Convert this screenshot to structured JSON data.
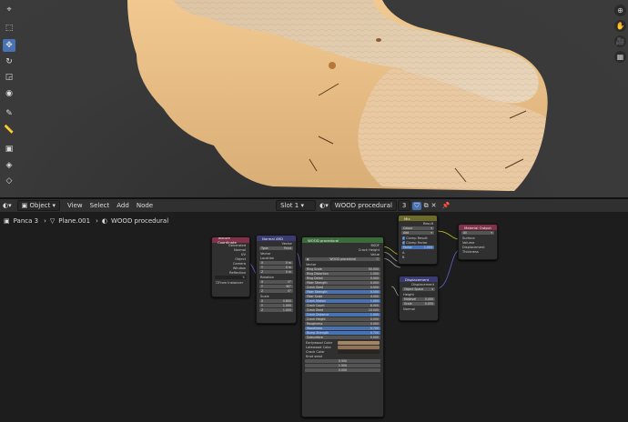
{
  "viewport": {
    "wood_color": "#e9c59b",
    "tools_left": [
      "cursor-icon",
      "select-icon",
      "move-icon",
      "rotate-icon",
      "scale-icon",
      "transform-icon",
      "annotate-icon",
      "measure-icon",
      "add-cube-icon",
      "uv-icon",
      "spin-icon"
    ],
    "tools_right": [
      "zoom-icon",
      "hand-icon",
      "camera-icon",
      "grid-icon"
    ]
  },
  "node_header": {
    "editor_type": "Object",
    "menus": [
      "View",
      "Select",
      "Add",
      "Node"
    ],
    "slot": "Slot 1",
    "material_name": "WOOD procedural",
    "user_count": "3"
  },
  "breadcrumb": {
    "object": "Panca 3",
    "mesh": "Plane.001",
    "material": "WOOD procedural"
  },
  "nodes": {
    "texcoord": {
      "title": "Texture Coordinate",
      "outputs": [
        "Generated",
        "Normal",
        "UV",
        "Object",
        "Camera",
        "Window",
        "Reflection"
      ],
      "object_field": "",
      "from_instancer": "From Instancer"
    },
    "mapping": {
      "title": "Normal ARD",
      "output": "Vector",
      "type_label": "Type:",
      "type_value": "Point",
      "vector": "Vector",
      "location": "Location",
      "location_values": [
        [
          "X",
          "0 m"
        ],
        [
          "Y",
          "0 m"
        ],
        [
          "Z",
          "0 m"
        ]
      ],
      "rotation": "Rotation",
      "rotation_values": [
        [
          "X",
          "0°"
        ],
        [
          "Y",
          "90°"
        ],
        [
          "Z",
          "0°"
        ]
      ],
      "scale": "Scale",
      "scale_values": [
        [
          "X",
          "0.800"
        ],
        [
          "Y",
          "1.000"
        ],
        [
          "Z",
          "1.000"
        ]
      ]
    },
    "wood": {
      "title": "WOOD procedural",
      "outputs": [
        "BSDF",
        "Crack Height",
        "Value"
      ],
      "group_name": "WOOD procedural",
      "vector": "Vector",
      "params": [
        [
          "Ring Scale",
          "50.000",
          false
        ],
        [
          "Ring Distortion",
          "1.000",
          false
        ],
        [
          "Ring Detail",
          "0.000",
          false
        ],
        [
          "Fiber Strength",
          "0.000",
          false
        ],
        [
          "Crack Seed",
          "0.000",
          false
        ],
        [
          "Fiber Strength",
          "0.500",
          true
        ],
        [
          "Fiber Scale",
          "4.000",
          false
        ],
        [
          "Crack Motion",
          "1.000",
          true
        ],
        [
          "Crack Count",
          "8.000",
          false
        ],
        [
          "Crack Seed",
          "10.000",
          false
        ],
        [
          "Crack Distance",
          "1.000",
          true
        ],
        [
          "Crack Height",
          "0.000",
          false
        ],
        [
          "Roughness",
          "0.000",
          false
        ],
        [
          "Woodiness",
          "0.700",
          true
        ],
        [
          "Bump Strength",
          "0.700",
          true
        ],
        [
          "Subsurface",
          "0.000",
          false
        ]
      ],
      "colors": [
        [
          "Earlywood Color",
          "#a48462"
        ],
        [
          "Latewood Color",
          "#8f7359"
        ],
        [
          "Crack Color",
          "#2a241f"
        ]
      ],
      "knot_seed": "Knot seed",
      "vector_values": [
        "0.500",
        "1.500",
        "0.000"
      ]
    },
    "mix": {
      "title": "Mix",
      "output": "Result",
      "type": "Colour",
      "blend": "Add",
      "clamp_result": "Clamp Result",
      "clamp_factor": "Clamp Factor",
      "factor_label": "Factor",
      "factor_value": "1.000",
      "a": "A",
      "b": "B"
    },
    "displacement": {
      "title": "Displacement",
      "output": "Displacement",
      "space": "Object Space",
      "height": "Height",
      "midlevel_label": "Midlevel",
      "midlevel": "0.000",
      "scale_label": "Scale",
      "scale": "0.050",
      "normal": "Normal"
    },
    "output": {
      "title": "Material Output",
      "target": "All",
      "inputs": [
        "Surface",
        "Volume",
        "Displacement",
        "Thickness"
      ]
    }
  },
  "colors": {
    "accent": "#4772b3",
    "texcoord_header": "#83314a",
    "mapping_header": "#3b3b73",
    "group_header": "#3c6b3a",
    "mix_header": "#6e6b2a",
    "displacement_header": "#3b3b73",
    "output_header": "#83314a",
    "vector_socket": "#6363c7",
    "color_socket": "#c7c729",
    "float_socket": "#a1a1a1",
    "shader_socket": "#63c763"
  }
}
